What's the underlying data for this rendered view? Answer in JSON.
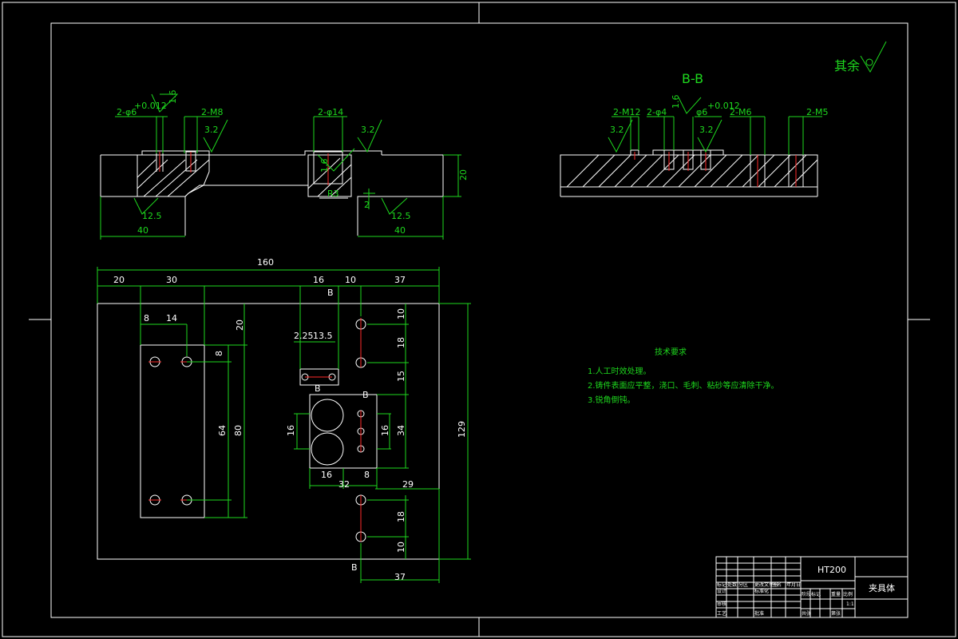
{
  "section_label": "B-B",
  "surface_roughness": {
    "remainder_label": "其余",
    "values": [
      "1.6",
      "3.2",
      "12.5",
      "1.6",
      "3.2",
      "3.2",
      "1.6",
      "12.5"
    ]
  },
  "callouts": {
    "top_view": [
      "2-φ6",
      "+0.012",
      "2-M8",
      "2-φ14",
      "R3",
      "2"
    ],
    "section_view": [
      "2-M12",
      "2-φ4",
      "φ6",
      "+0.012",
      "2-M6",
      "2-M5"
    ]
  },
  "dimensions": {
    "top_view": [
      "20",
      "40",
      "40"
    ],
    "plan_view": [
      "160",
      "20",
      "30",
      "16",
      "10",
      "37",
      "8",
      "14",
      "20",
      "8",
      "64",
      "80",
      "10",
      "18",
      "2.25",
      "13.5",
      "15",
      "16",
      "34",
      "16",
      "16",
      "32",
      "8",
      "129",
      "29",
      "18",
      "10",
      "37"
    ],
    "section_marks": [
      "B",
      "B",
      "B",
      "B"
    ]
  },
  "technical_requirements": {
    "heading": "技术要求",
    "items": [
      "1.人工时效处理。",
      "2.铸件表面应平整，浇口、毛刺、粘砂等应清除干净。",
      "3.锐角倒钝。"
    ]
  },
  "title_block": {
    "material": "HT200",
    "part_name": "夹具体",
    "row_labels": [
      "标记",
      "处数",
      "分区",
      "更改文件号",
      "签名",
      "年月日",
      "设计",
      "标准化",
      "审核",
      "工艺",
      "批准",
      "阶段标记",
      "重量",
      "比例",
      "共张",
      "第张"
    ],
    "scale": "1:1"
  }
}
